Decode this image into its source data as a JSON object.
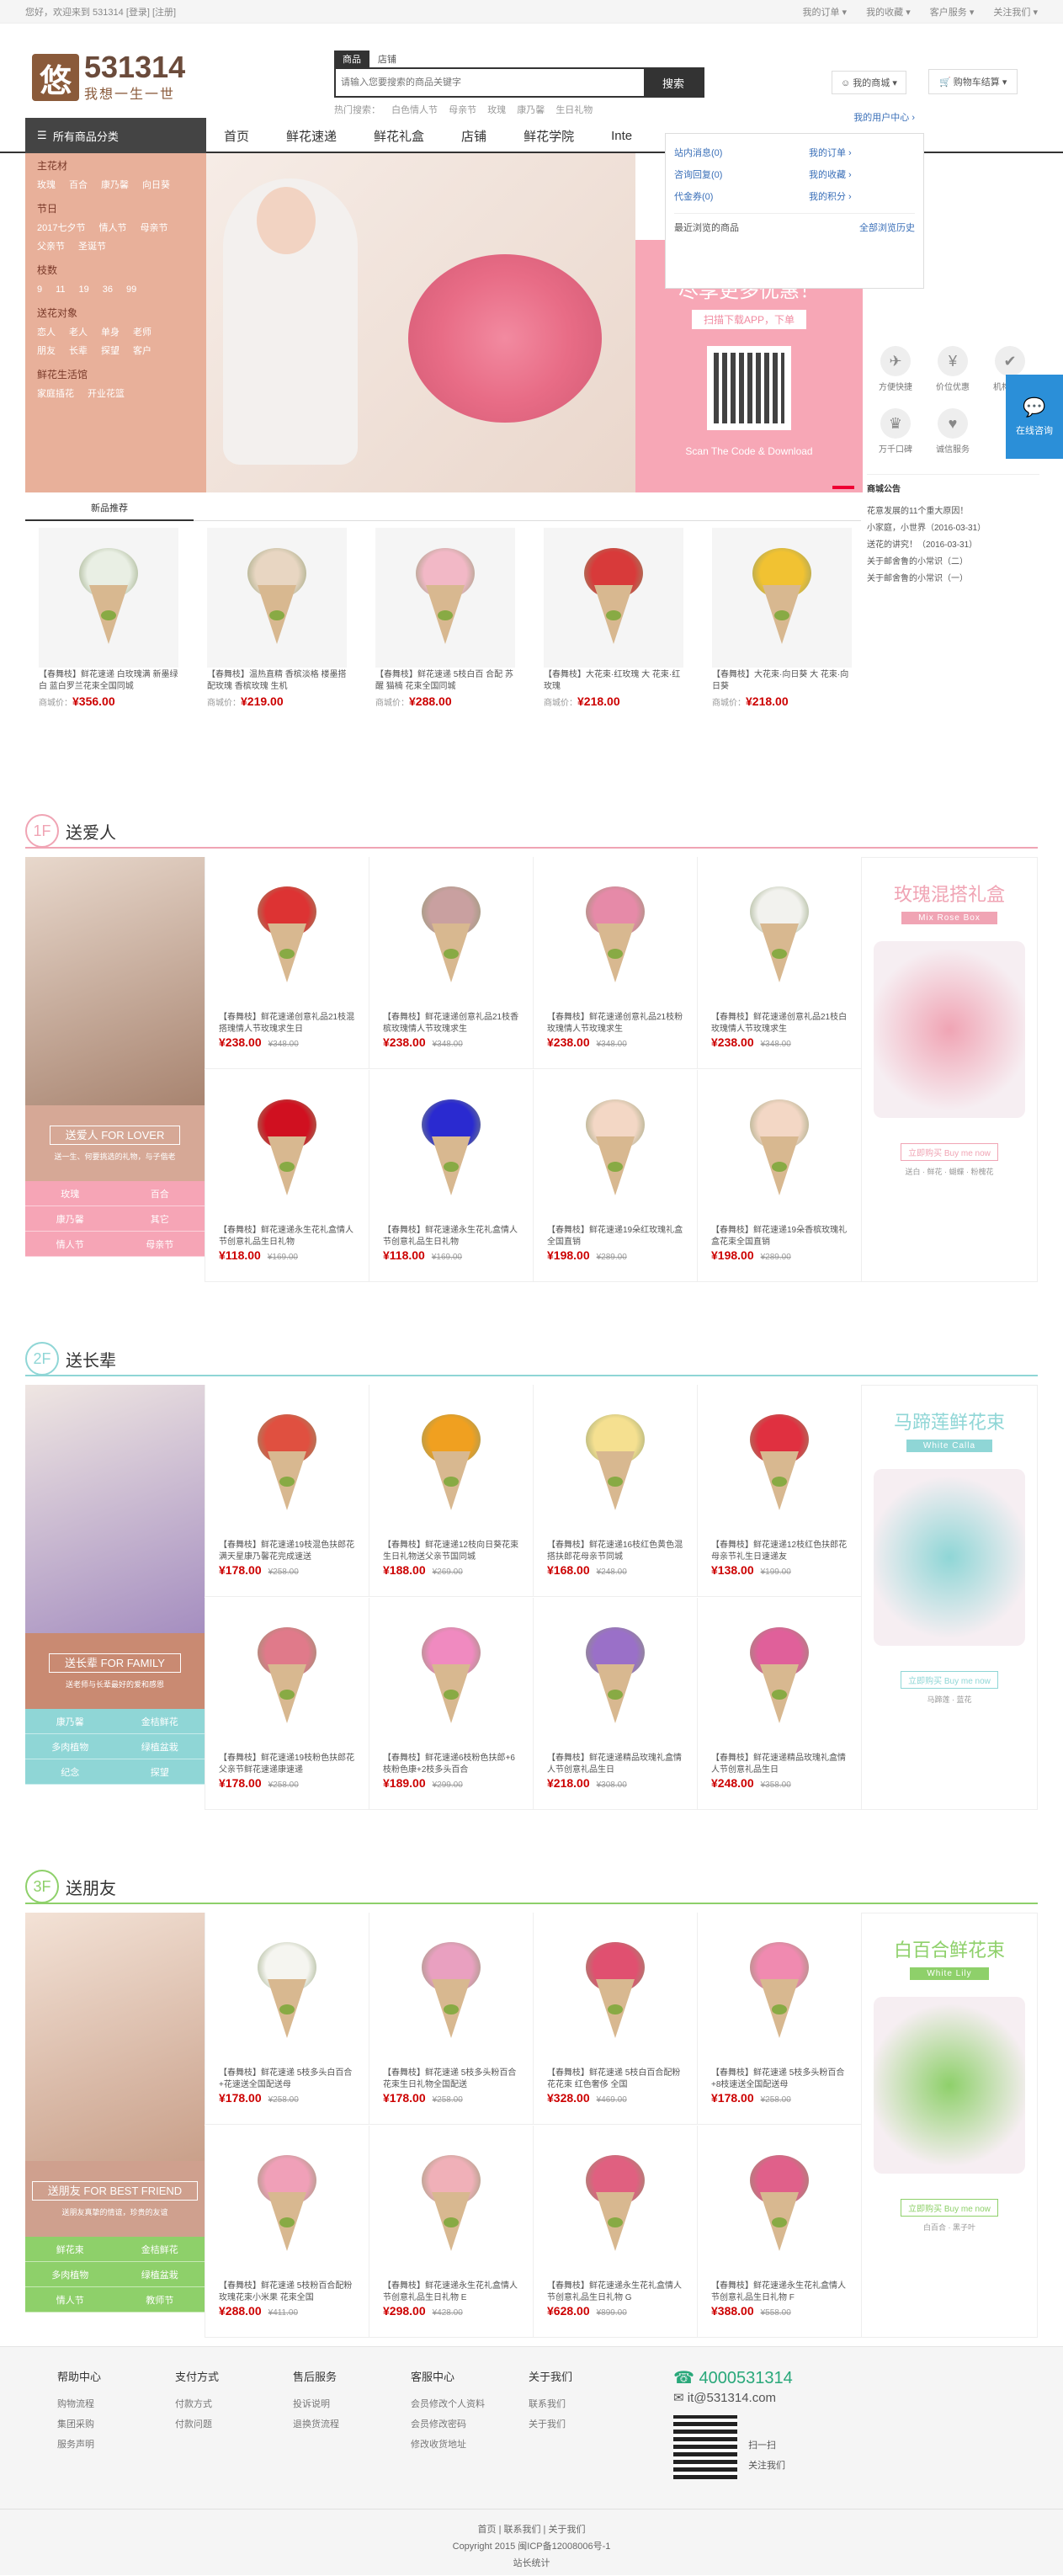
{
  "topbar": {
    "welcome": "您好，欢迎来到 531314 [登录] [注册]",
    "links": [
      "我的订单 ▾",
      "我的收藏 ▾",
      "客户服务 ▾",
      "关注我们 ▾"
    ]
  },
  "logo": {
    "mark": "悠",
    "number": "531314",
    "slogan": "我想一生一世"
  },
  "search": {
    "tabs": [
      "商品",
      "店铺"
    ],
    "placeholder": "请输入您要搜索的商品关键字",
    "button": "搜索",
    "hot_label": "热门搜索：",
    "hot": [
      "白色情人节",
      "母亲节",
      "玫瑰",
      "康乃馨",
      "生日礼物"
    ]
  },
  "mymall": "我的商城 ▾",
  "cart": "购物车结算 ▾",
  "dropdown": {
    "user_center": "我的用户中心 ›",
    "left": [
      "站内消息(0)",
      "咨询回复(0)",
      "代金券(0)"
    ],
    "right": [
      "我的订单 ›",
      "我的收藏 ›",
      "我的积分 ›"
    ],
    "recent": "最近浏览的商品",
    "history": "全部浏览历史"
  },
  "nav": {
    "all": "所有商品分类",
    "items": [
      "首页",
      "鲜花速递",
      "鲜花礼盒",
      "店铺",
      "鲜花学院",
      "Inte"
    ]
  },
  "catmenu": [
    {
      "title": "主花材",
      "items": [
        "玫瑰",
        "百合",
        "康乃馨",
        "向日葵"
      ]
    },
    {
      "title": "节日",
      "items": [
        "2017七夕节",
        "情人节",
        "母亲节",
        "父亲节",
        "圣诞节"
      ]
    },
    {
      "title": "枝数",
      "items": [
        "9",
        "11",
        "19",
        "36",
        "99"
      ]
    },
    {
      "title": "送花对象",
      "items": [
        "恋人",
        "老人",
        "单身",
        "老师",
        "朋友",
        "长辈",
        "探望",
        "客户"
      ]
    },
    {
      "title": "鲜花生活馆",
      "items": [
        "家庭插花",
        "开业花篮"
      ]
    }
  ],
  "app": {
    "title": "尽享更多优惠！",
    "download": "扫描下载APP，下单",
    "scan": "Scan The Code & Download"
  },
  "service": {
    "icons": [
      "方便快捷",
      "价位优惠",
      "机构认证",
      "万千口碑",
      "诚信服务"
    ],
    "ann_title": "商城公告",
    "ann": [
      "花意发展的11个重大原因！",
      "小家庭，小世界（2016-03-31）",
      "送花的讲究！（2016-03-31）",
      "关于邮舍鲁的小常识（二）",
      "关于邮舍鲁的小常识（一）"
    ]
  },
  "consult": "在线咨询",
  "newp": {
    "tab": "新品推荐",
    "items": [
      {
        "desc": "【春舞枝】鲜花速递 白玫瑰满 新墨绿白 蓝白罗兰花束全国同城",
        "label": "商城价：",
        "price": "¥356.00",
        "head": "#e9efe4"
      },
      {
        "desc": "【春舞枝】温热直精 香槟淡格 楼墨搭配玫瑰 香槟玫瑰 生机",
        "label": "商城价：",
        "price": "¥219.00",
        "head": "#e8d6c2"
      },
      {
        "desc": "【春舞枝】鲜花速递 5枝白百 合配 苏醒 猫楠 花束全国同城",
        "label": "商城价：",
        "price": "¥288.00",
        "head": "#f2b8c6"
      },
      {
        "desc": "【春舞枝】大花束·红玫瑰 大 花束·红玫瑰",
        "label": "商城价：",
        "price": "¥218.00",
        "head": "#d83a3a"
      },
      {
        "desc": "【春舞枝】大花束·向日葵 大 花束·向日葵",
        "label": "商城价：",
        "price": "¥218.00",
        "head": "#f1c232"
      }
    ]
  },
  "floors": [
    {
      "num": "1F",
      "title": "送爱人",
      "color": "#f0a4b4",
      "tag": "送爱人 FOR LOVER",
      "tagline": "送一生、何要挑选的礼物，与子偕老",
      "keywords": [
        "玫瑰",
        "百合",
        "康乃馨",
        "其它",
        "情人节",
        "母亲节"
      ],
      "right": {
        "title": "玫瑰混搭礼盒",
        "sub": "Mix Rose Box",
        "buy": "立即购买   Buy me now",
        "small": "送白 · 鲜花 · 蝴蝶 · 粉槐花"
      },
      "products": [
        {
          "desc": "【春舞枝】鲜花速递创意礼品21枝混搭瑰情人节玫瑰求生日",
          "price": "¥238.00",
          "old": "¥348.00",
          "c": "#d33"
        },
        {
          "desc": "【春舞枝】鲜花速递创意礼品21枝香槟玫瑰情人节玫瑰求生",
          "price": "¥238.00",
          "old": "¥348.00",
          "c": "#c9a0a0"
        },
        {
          "desc": "【春舞枝】鲜花速递创意礼品21枝粉玫瑰情人节玫瑰求生",
          "price": "¥238.00",
          "old": "¥348.00",
          "c": "#e68aa8"
        },
        {
          "desc": "【春舞枝】鲜花速递创意礼品21枝白玫瑰情人节玫瑰求生",
          "price": "¥238.00",
          "old": "¥348.00",
          "c": "#f2f2ee"
        },
        {
          "desc": "【春舞枝】鲜花速递永生花礼盒情人节创意礼品生日礼物",
          "price": "¥118.00",
          "old": "¥169.00",
          "c": "#d01020"
        },
        {
          "desc": "【春舞枝】鲜花速递永生花礼盒情人节创意礼品生日礼物",
          "price": "¥118.00",
          "old": "¥169.00",
          "c": "#2a2ad0"
        },
        {
          "desc": "【春舞枝】鲜花速递19朵红玫瑰礼盒全国直销",
          "price": "¥198.00",
          "old": "¥289.00",
          "c": "#f3d7c5"
        },
        {
          "desc": "【春舞枝】鲜花速递19朵香槟玫瑰礼盒花束全国直销",
          "price": "¥198.00",
          "old": "¥289.00",
          "c": "#f3d7c5"
        }
      ]
    },
    {
      "num": "2F",
      "title": "送长辈",
      "color": "#8fd6d6",
      "tag": "送长辈 FOR FAMILY",
      "tagline": "送老师与长辈最好的爱和感恩",
      "keywords": [
        "康乃馨",
        "金桔鲜花",
        "多肉植物",
        "绿植盆栽",
        "纪念",
        "探望"
      ],
      "right": {
        "title": "马蹄莲鲜花束",
        "sub": "White Calla",
        "buy": "立即购买   Buy me now",
        "small": "马蹄莲 · 蓝花"
      },
      "products": [
        {
          "desc": "【春舞枝】鲜花速递19枝混色扶郎花满天星康乃馨花完成速送",
          "price": "¥178.00",
          "old": "¥258.00",
          "c": "#e05040"
        },
        {
          "desc": "【春舞枝】鲜花速递12枝向日葵花束生日礼物送父亲节国同城",
          "price": "¥188.00",
          "old": "¥269.00",
          "c": "#f0a020"
        },
        {
          "desc": "【春舞枝】鲜花速递16枝红色黄色混搭扶郎花母亲节同城",
          "price": "¥168.00",
          "old": "¥248.00",
          "c": "#f5e090"
        },
        {
          "desc": "【春舞枝】鲜花速递12枝红色扶郎花母亲节礼生日速递友",
          "price": "¥138.00",
          "old": "¥199.00",
          "c": "#e03040"
        },
        {
          "desc": "【春舞枝】鲜花速递19枝粉色扶郎花父亲节鲜花速递康速递",
          "price": "¥178.00",
          "old": "¥258.00",
          "c": "#e07a8a"
        },
        {
          "desc": "【春舞枝】鲜花速递6枝粉色扶郎+6枝粉色康+2枝多头百合",
          "price": "¥189.00",
          "old": "¥299.00",
          "c": "#f08ac0"
        },
        {
          "desc": "【春舞枝】鲜花速递精品玫瑰礼盒情人节创意礼品生日",
          "price": "¥218.00",
          "old": "¥308.00",
          "c": "#9a70c8"
        },
        {
          "desc": "【春舞枝】鲜花速递精品玫瑰礼盒情人节创意礼品生日",
          "price": "¥248.00",
          "old": "¥358.00",
          "c": "#e0609a"
        }
      ]
    },
    {
      "num": "3F",
      "title": "送朋友",
      "color": "#8ed06a",
      "tag": "送朋友 FOR BEST FRIEND",
      "tagline": "送朋友真挚的情谊，珍贵的友谊",
      "keywords": [
        "鲜花束",
        "金桔鲜花",
        "多肉植物",
        "绿植盆栽",
        "情人节",
        "教师节"
      ],
      "right": {
        "title": "白百合鲜花束",
        "sub": "White Lily",
        "buy": "立即购买   Buy me now",
        "small": "白百合 · 黑子叶"
      },
      "products": [
        {
          "desc": "【春舞枝】鲜花速递 5枝多头白百合+花速送全国配送母",
          "price": "¥178.00",
          "old": "¥258.00",
          "c": "#f5f5f0"
        },
        {
          "desc": "【春舞枝】鲜花速递 5枝多头粉百合花束生日礼物全国配送",
          "price": "¥178.00",
          "old": "¥258.00",
          "c": "#e9a0c0"
        },
        {
          "desc": "【春舞枝】鲜花速递 5枝白百合配粉花花束 红色奢侈 全国",
          "price": "¥328.00",
          "old": "¥469.00",
          "c": "#e05070"
        },
        {
          "desc": "【春舞枝】鲜花速递 5枝多头粉百合+8枝速送全国配送母",
          "price": "¥178.00",
          "old": "¥258.00",
          "c": "#f08ab0"
        },
        {
          "desc": "【春舞枝】鲜花速递 5枝粉百合配粉玫瑰花束小米果 花束全国",
          "price": "¥288.00",
          "old": "¥411.00",
          "c": "#f0a0b8"
        },
        {
          "desc": "【春舞枝】鲜花速递永生花礼盒情人节创意礼品生日礼物 E",
          "price": "¥298.00",
          "old": "¥428.00",
          "c": "#f0b0b8"
        },
        {
          "desc": "【春舞枝】鲜花速递永生花礼盒情人节创意礼品生日礼物 G",
          "price": "¥628.00",
          "old": "¥899.00",
          "c": "#e06080"
        },
        {
          "desc": "【春舞枝】鲜花速递永生花礼盒情人节创意礼品生日礼物 F",
          "price": "¥388.00",
          "old": "¥558.00",
          "c": "#e0608a"
        }
      ]
    }
  ],
  "footer": {
    "cols": [
      {
        "title": "帮助中心",
        "items": [
          "购物流程",
          "集团采购",
          "服务声明"
        ]
      },
      {
        "title": "支付方式",
        "items": [
          "付款方式",
          "付款问题"
        ]
      },
      {
        "title": "售后服务",
        "items": [
          "投诉说明",
          "退换货流程"
        ]
      },
      {
        "title": "客服中心",
        "items": [
          "会员修改个人资料",
          "会员修改密码",
          "修改收货地址"
        ]
      },
      {
        "title": "关于我们",
        "items": [
          "联系我们",
          "关于我们"
        ]
      }
    ],
    "phone": "4000531314",
    "mail": "it@531314.com",
    "qr_text": [
      "扫一扫",
      "关注我们"
    ],
    "bottom_links": "首页  |  联系我们  |  关于我们",
    "copyright": "Copyright 2015 闽ICP备12008006号-1",
    "stats": "站长统计"
  }
}
